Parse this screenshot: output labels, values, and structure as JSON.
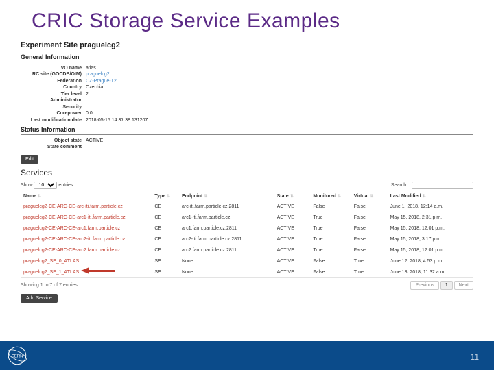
{
  "slide": {
    "title": "CRIC Storage Service Examples",
    "page_number": "11"
  },
  "header": {
    "experiment_site_label": "Experiment Site",
    "experiment_site_value": "praguelcg2"
  },
  "general": {
    "section_title": "General Information",
    "vo_name_k": "VO name",
    "vo_name_v": "atlas",
    "rc_site_k": "RC site (GOCDB/OIM)",
    "rc_site_v": "praguelcg2",
    "federation_k": "Federation",
    "federation_v": "CZ-Prague-T2",
    "country_k": "Country",
    "country_v": "Czechia",
    "tier_k": "Tier level",
    "tier_v": "2",
    "admin_k": "Administrator",
    "admin_v": "",
    "sec_k": "Security",
    "sec_v": "",
    "core_k": "Corepower",
    "core_v": "0.0",
    "lmd_k": "Last modification date",
    "lmd_v": "2018-05-15 14:37:38.131207"
  },
  "status": {
    "section_title": "Status Information",
    "obj_state_k": "Object state",
    "obj_state_v": "ACTIVE",
    "stc_k": "State comment",
    "stc_v": ""
  },
  "buttons": {
    "edit": "Edit",
    "add_service": "Add Service",
    "previous": "Previous",
    "next": "Next",
    "page1": "1"
  },
  "services": {
    "title": "Services",
    "show_label": "Show",
    "entries_label": "entries",
    "page_size": "10",
    "search_label": "Search:",
    "showing": "Showing 1 to 7 of 7 entries",
    "columns": {
      "name": "Name",
      "type": "Type",
      "endpoint": "Endpoint",
      "state": "State",
      "monitored": "Monitored",
      "virtual": "Virtual",
      "last_modified": "Last Modified"
    },
    "rows": [
      {
        "name": "praguelcg2-CE-ARC-CE-arc-iti.farm.particle.cz",
        "type": "CE",
        "endpoint": "arc-iti.farm.particle.cz:2811",
        "state": "ACTIVE",
        "mon": "False",
        "virt": "False",
        "lm": "June 1, 2018, 12:14 a.m."
      },
      {
        "name": "praguelcg2-CE-ARC-CE-arc1-iti.farm.particle.cz",
        "type": "CE",
        "endpoint": "arc1-iti.farm.particle.cz",
        "state": "ACTIVE",
        "mon": "True",
        "virt": "False",
        "lm": "May 15, 2018, 2:31 p.m."
      },
      {
        "name": "praguelcg2-CE-ARC-CE-arc1.farm.particle.cz",
        "type": "CE",
        "endpoint": "arc1.farm.particle.cz:2811",
        "state": "ACTIVE",
        "mon": "True",
        "virt": "False",
        "lm": "May 15, 2018, 12:01 p.m."
      },
      {
        "name": "praguelcg2-CE-ARC-CE-arc2-iti.farm.particle.cz",
        "type": "CE",
        "endpoint": "arc2-iti.farm.particle.cz:2811",
        "state": "ACTIVE",
        "mon": "True",
        "virt": "False",
        "lm": "May 15, 2018, 3:17 p.m."
      },
      {
        "name": "praguelcg2-CE-ARC-CE-arc2.farm.particle.cz",
        "type": "CE",
        "endpoint": "arc2.farm.particle.cz:2811",
        "state": "ACTIVE",
        "mon": "True",
        "virt": "False",
        "lm": "May 15, 2018, 12:01 p.m."
      },
      {
        "name": "praguelcg2_SE_0_ATLAS",
        "type": "SE",
        "endpoint": "None",
        "state": "ACTIVE",
        "mon": "False",
        "virt": "True",
        "lm": "June 12, 2018, 4:53 p.m."
      },
      {
        "name": "praguelcg2_SE_1_ATLAS",
        "type": "SE",
        "endpoint": "None",
        "state": "ACTIVE",
        "mon": "False",
        "virt": "True",
        "lm": "June 13, 2018, 11:32 a.m."
      }
    ]
  }
}
